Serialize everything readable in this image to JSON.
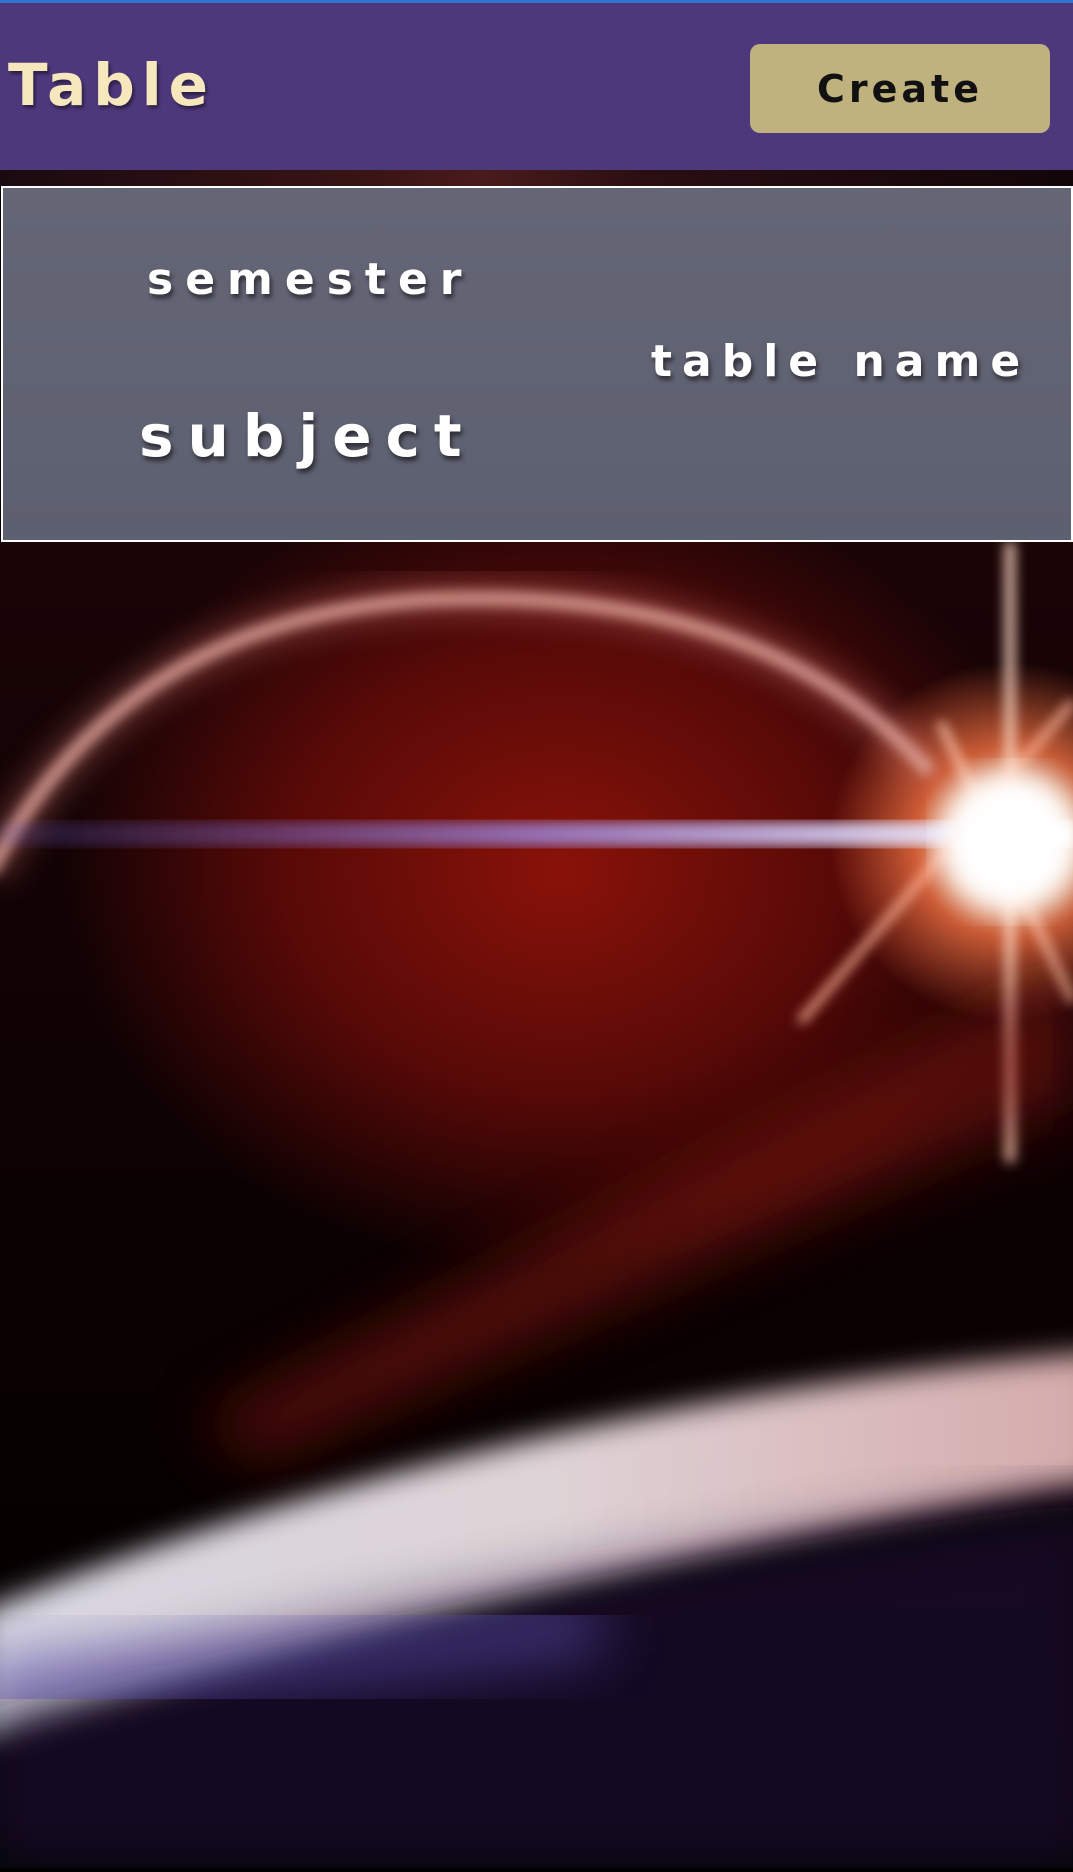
{
  "header": {
    "title": "Table",
    "create_label": "Create",
    "accent_color": "#4e387c",
    "button_color": "#bfb27e"
  },
  "form": {
    "semester_label": "semester",
    "table_name_label": "table name",
    "subject_label": "subject"
  }
}
